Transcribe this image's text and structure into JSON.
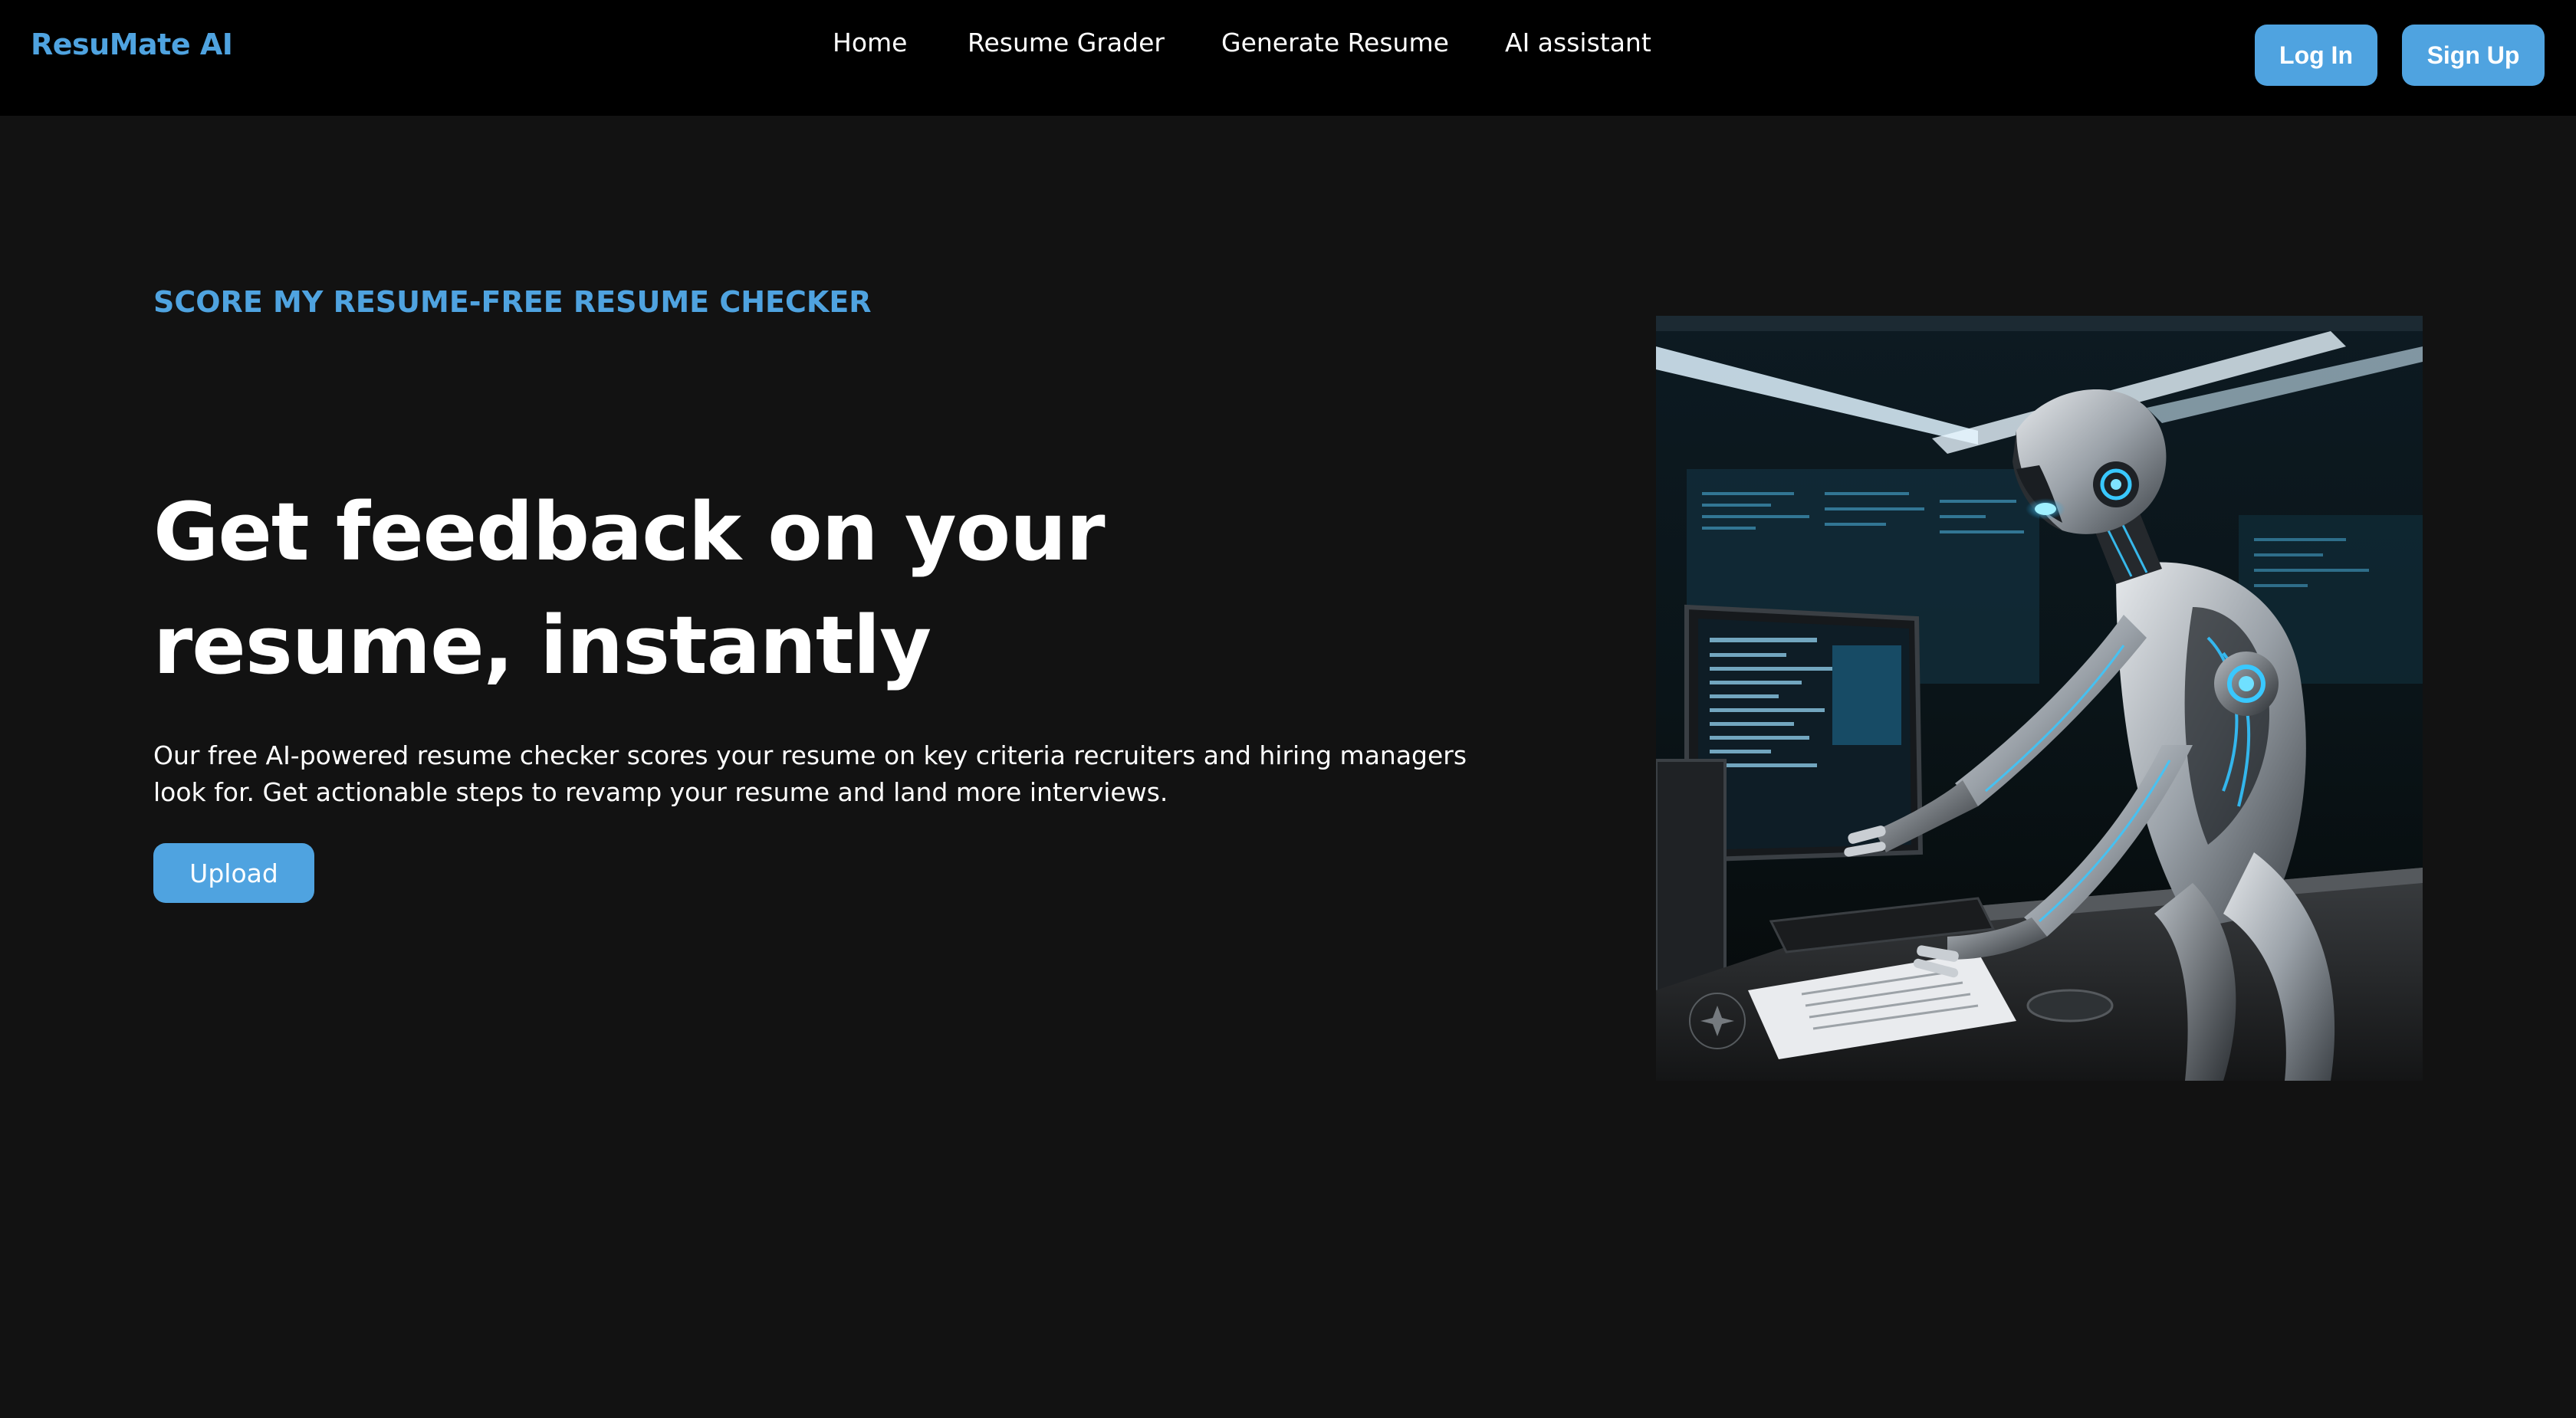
{
  "header": {
    "brand": "ResuMate AI",
    "nav": [
      {
        "label": "Home"
      },
      {
        "label": "Resume Grader"
      },
      {
        "label": "Generate Resume"
      },
      {
        "label": "AI assistant"
      }
    ],
    "login_label": "Log In",
    "signup_label": "Sign Up"
  },
  "hero": {
    "eyebrow": "SCORE MY RESUME-FREE RESUME CHECKER",
    "title": "Get feedback on your resume, instantly",
    "description": "Our free AI-powered resume checker scores your resume on key criteria recruiters and hiring managers look for. Get actionable steps to revamp your resume and land more interviews.",
    "upload_label": "Upload"
  },
  "colors": {
    "accent": "#4fa3e0",
    "nav_background": "#000000",
    "page_background": "#121212"
  }
}
